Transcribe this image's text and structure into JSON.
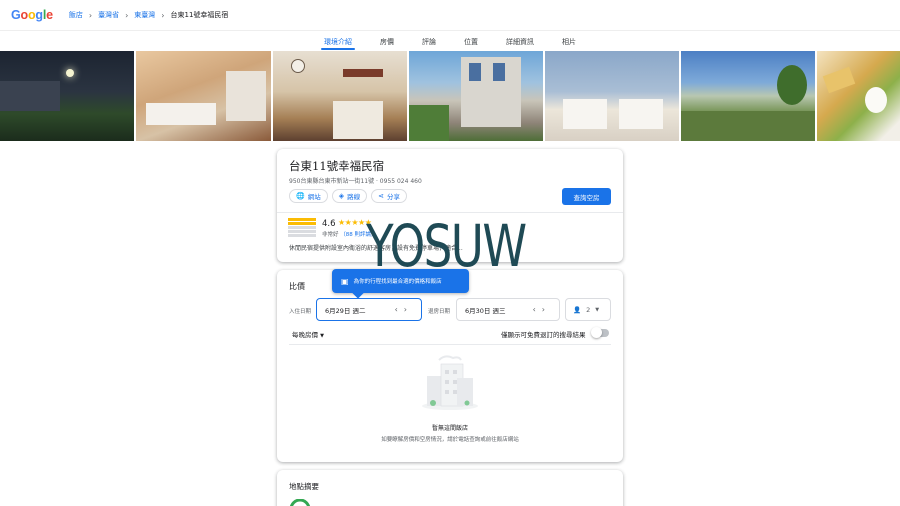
{
  "topbar": {
    "logo_letters": [
      {
        "ch": "G",
        "color": "#4285F4"
      },
      {
        "ch": "o",
        "color": "#EA4335"
      },
      {
        "ch": "o",
        "color": "#FBBC05"
      },
      {
        "ch": "g",
        "color": "#4285F4"
      },
      {
        "ch": "l",
        "color": "#34A853"
      },
      {
        "ch": "e",
        "color": "#EA4335"
      }
    ],
    "breadcrumbs": [
      "飯店",
      "臺灣省",
      "東臺灣",
      "台東11號幸福民宿"
    ]
  },
  "tabs": [
    {
      "label": "環境介紹",
      "active": true
    },
    {
      "label": "房價",
      "active": false
    },
    {
      "label": "評論",
      "active": false
    },
    {
      "label": "位置",
      "active": false
    },
    {
      "label": "詳細資訊",
      "active": false
    },
    {
      "label": "相片",
      "active": false
    }
  ],
  "hotel": {
    "name": "台東11號幸福民宿",
    "address": "950台東縣台東市新站一街11號 · 0955 024 460",
    "chips": [
      {
        "icon": "globe-icon",
        "glyph": "🌐",
        "label": "網站"
      },
      {
        "icon": "directions-icon",
        "glyph": "◈",
        "label": "路線"
      },
      {
        "icon": "share-icon",
        "glyph": "⋖",
        "label": "分享"
      }
    ],
    "check_button": "查詢空房",
    "rating": "4.6",
    "stars": "★★★★★",
    "rating_word": "非常好",
    "reviews": "（88 則評論）",
    "description": "休閒民宿提供附設室內衛浴的舒適客房，設有免費停車場，適合..."
  },
  "price": {
    "title": "比價",
    "tooltip": "為你的行程找到最合適的價格和飯店",
    "checkin_label": "入住日期",
    "checkin_value": "6月29日 週二",
    "checkout_label": "退房日期",
    "checkout_value": "6月30日 週三",
    "guests_value": "2",
    "nightly_label": "每晚房價",
    "toggle_label": "僅顯示可免費退訂的搜尋結果",
    "empty_title": "暫無這間飯店",
    "empty_subtitle": "如要瞭解房價和空房情況，請於電話查詢或前往飯店網站"
  },
  "map": {
    "title": "地點摘要"
  },
  "watermark": "YOSUW",
  "colors": {
    "accent": "#1a73e8",
    "star": "#fbbc04"
  }
}
